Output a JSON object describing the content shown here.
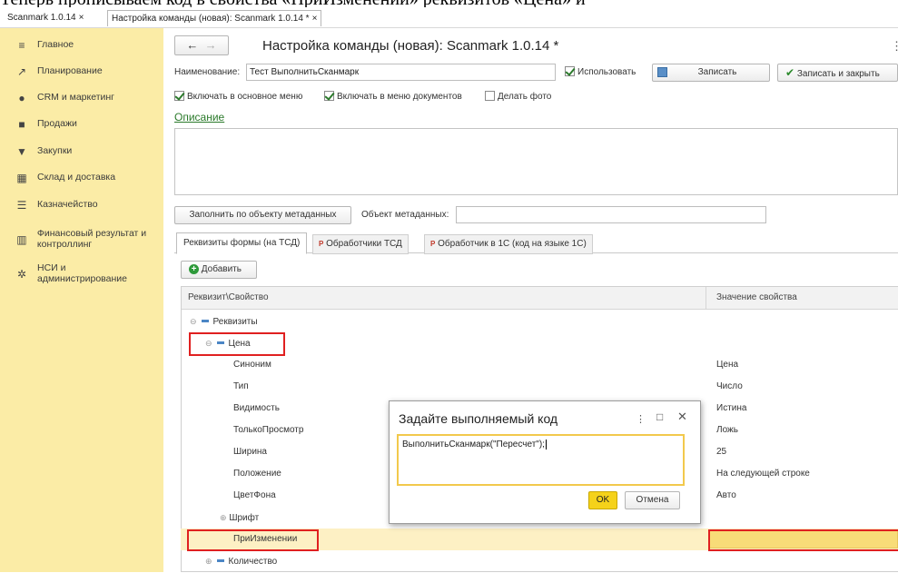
{
  "top_text": "Теперь прописываем код в свойства «ПриИзменении» реквизитов «Цена» и",
  "tabs": [
    {
      "label": "Scanmark 1.0.14",
      "close": "×"
    },
    {
      "label": "Настройка команды (новая): Scanmark 1.0.14 *",
      "close": "×"
    }
  ],
  "sidebar": {
    "items": [
      {
        "label": "Главное",
        "icon": "menu-icon"
      },
      {
        "label": "Планирование",
        "icon": "chart-icon"
      },
      {
        "label": "CRM и маркетинг",
        "icon": "crm-icon"
      },
      {
        "label": "Продажи",
        "icon": "bag-icon"
      },
      {
        "label": "Закупки",
        "icon": "cart-icon"
      },
      {
        "label": "Склад и доставка",
        "icon": "warehouse-icon"
      },
      {
        "label": "Казначейство",
        "icon": "treasury-icon"
      },
      {
        "label": "Финансовый результат и контроллинг",
        "icon": "bar-chart-icon"
      },
      {
        "label": "НСИ и администрирование",
        "icon": "gear-icon"
      }
    ]
  },
  "form": {
    "title": "Настройка команды (новая): Scanmark 1.0.14 *",
    "more": "⋮",
    "name_label": "Наименование:",
    "name_value": "Тест ВыполнитьСканмарк",
    "use_label": "Использовать",
    "save_label": "Записать",
    "save_close_label": "Записать и закрыть",
    "include_main_menu": "Включать в основное меню",
    "include_docs_menu": "Включать в меню документов",
    "make_photo": "Делать фото",
    "description_link": "Описание",
    "fill_button": "Заполнить по объекту метаданных",
    "meta_object_label": "Объект метаданных:",
    "inner_tabs": [
      "Реквизиты формы (на ТСД)",
      "Обработчики ТСД",
      "Обработчик в 1С  (код на языке 1С)"
    ],
    "add_button": "Добавить"
  },
  "table": {
    "headers": [
      "Реквизит\\Свойство",
      "Значение свойства"
    ],
    "rows": [
      {
        "name": "Реквизиты",
        "value": ""
      },
      {
        "name": "Цена",
        "value": ""
      },
      {
        "name": "Синоним",
        "value": "Цена"
      },
      {
        "name": "Тип",
        "value": "Число"
      },
      {
        "name": "Видимость",
        "value": "Истина"
      },
      {
        "name": "ТолькоПросмотр",
        "value": "Ложь"
      },
      {
        "name": "Ширина",
        "value": "25"
      },
      {
        "name": "Положение",
        "value": "На следующей строке"
      },
      {
        "name": "ЦветФона",
        "value": "Авто"
      },
      {
        "name": "Шрифт",
        "value": ""
      },
      {
        "name": "ПриИзменении",
        "value": ""
      },
      {
        "name": "Количество",
        "value": ""
      }
    ]
  },
  "dialog": {
    "title": "Задайте выполняемый код",
    "code": "ВыполнитьСканмарк(\"Пересчет\");",
    "ok": "OK",
    "cancel": "Отмена"
  },
  "colors": {
    "sidebar": "#fbeca6",
    "highlight": "#fdf0c4",
    "red": "#e02020",
    "link": "#2a7a2a",
    "ok": "#f5d21a"
  }
}
